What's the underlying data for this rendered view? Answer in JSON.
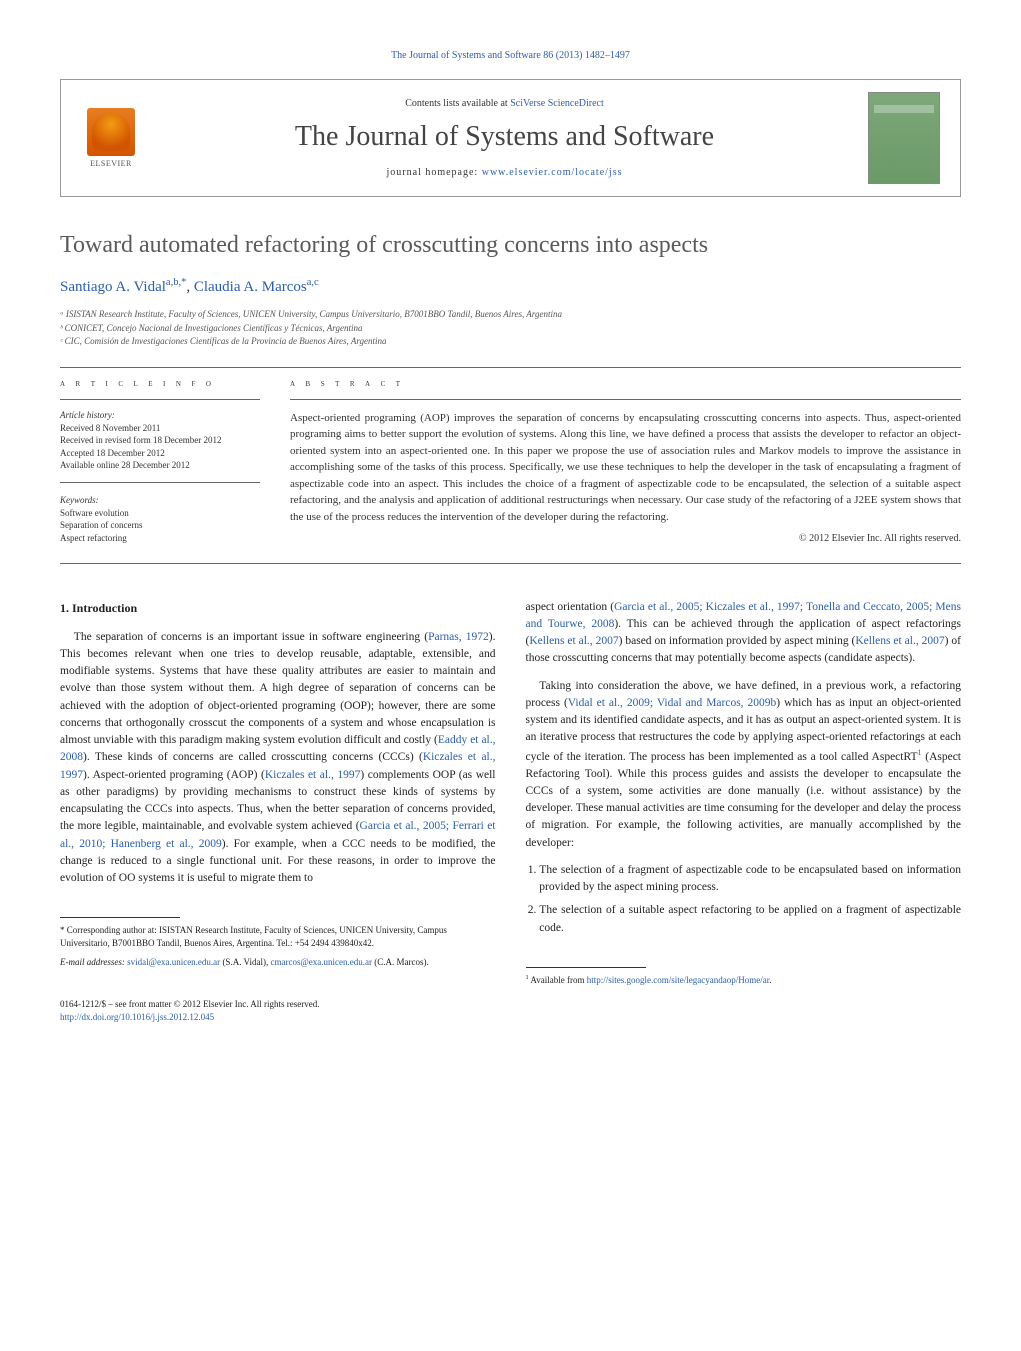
{
  "header_citation": "The Journal of Systems and Software 86 (2013) 1482–1497",
  "contents_line_prefix": "Contents lists available at ",
  "contents_line_link": "SciVerse ScienceDirect",
  "journal_title": "The Journal of Systems and Software",
  "homepage_prefix": "journal homepage: ",
  "homepage_link": "www.elsevier.com/locate/jss",
  "elsevier_label": "ELSEVIER",
  "article_title": "Toward automated refactoring of crosscutting concerns into aspects",
  "authors": {
    "a1_name": "Santiago A. Vidal",
    "a1_aff": "a,b,",
    "a1_star": "*",
    "sep": ", ",
    "a2_name": "Claudia A. Marcos",
    "a2_aff": "a,c"
  },
  "affiliations": {
    "a": "ᵃ ISISTAN Research Institute, Faculty of Sciences, UNICEN University, Campus Universitario, B7001BBO Tandil, Buenos Aires, Argentina",
    "b": "ᵇ CONICET, Concejo Nacional de Investigaciones Científicas y Técnicas, Argentina",
    "c": "ᶜ CIC, Comisión de Investigaciones Científicas de la Provincia de Buenos Aires, Argentina"
  },
  "info_header": "A R T I C L E   I N F O",
  "abstract_header": "A B S T R A C T",
  "history": {
    "label": "Article history:",
    "received": "Received 8 November 2011",
    "revised": "Received in revised form 18 December 2012",
    "accepted": "Accepted 18 December 2012",
    "online": "Available online 28 December 2012"
  },
  "keywords": {
    "label": "Keywords:",
    "k1": "Software evolution",
    "k2": "Separation of concerns",
    "k3": "Aspect refactoring"
  },
  "abstract_text": "Aspect-oriented programing (AOP) improves the separation of concerns by encapsulating crosscutting concerns into aspects. Thus, aspect-oriented programing aims to better support the evolution of systems. Along this line, we have defined a process that assists the developer to refactor an object-oriented system into an aspect-oriented one. In this paper we propose the use of association rules and Markov models to improve the assistance in accomplishing some of the tasks of this process. Specifically, we use these techniques to help the developer in the task of encapsulating a fragment of aspectizable code into an aspect. This includes the choice of a fragment of aspectizable code to be encapsulated, the selection of a suitable aspect refactoring, and the analysis and application of additional restructurings when necessary. Our case study of the refactoring of a J2EE system shows that the use of the process reduces the intervention of the developer during the refactoring.",
  "copyright": "© 2012 Elsevier Inc. All rights reserved.",
  "section1_heading": "1.  Introduction",
  "col1_p1_a": "The separation of concerns is an important issue in software engineering (",
  "col1_p1_ref1": "Parnas, 1972",
  "col1_p1_b": "). This becomes relevant when one tries to develop reusable, adaptable, extensible, and modifiable systems. Systems that have these quality attributes are easier to maintain and evolve than those system without them. A high degree of separation of concerns can be achieved with the adoption of object-oriented programing (OOP); however, there are some concerns that orthogonally crosscut the components of a system and whose encapsulation is almost unviable with this paradigm making system evolution difficult and costly (",
  "col1_p1_ref2": "Eaddy et al., 2008",
  "col1_p1_c": "). These kinds of concerns are called crosscutting concerns (CCCs) (",
  "col1_p1_ref3": "Kiczales et al., 1997",
  "col1_p1_d": "). Aspect-oriented programing (AOP) (",
  "col1_p1_ref4": "Kiczales et al., 1997",
  "col1_p1_e": ") complements OOP (as well as other paradigms) by providing mechanisms to construct these kinds of systems by encapsulating the CCCs into aspects. Thus, when the better separation of concerns provided, the more legible, maintainable, and evolvable system achieved (",
  "col1_p1_ref5": "Garcia et al., 2005; Ferrari et al., 2010; Hanenberg et al., 2009",
  "col1_p1_f": "). For example, when a CCC needs to be modified, the change is reduced to a single functional unit. For these reasons, in order to improve the evolution of OO systems it is useful to migrate them to",
  "col2_p1_a": "aspect orientation (",
  "col2_p1_ref1": "Garcia et al., 2005; Kiczales et al., 1997; Tonella and Ceccato, 2005; Mens and Tourwe, 2008",
  "col2_p1_b": "). This can be achieved through the application of aspect refactorings (",
  "col2_p1_ref2": "Kellens et al., 2007",
  "col2_p1_c": ") based on information provided by aspect mining (",
  "col2_p1_ref3": "Kellens et al., 2007",
  "col2_p1_d": ") of those crosscutting concerns that may potentially become aspects (candidate aspects).",
  "col2_p2_a": "Taking into consideration the above, we have defined, in a previous work, a refactoring process (",
  "col2_p2_ref1": "Vidal et al., 2009; Vidal and Marcos, 2009b",
  "col2_p2_b": ") which has as input an object-oriented system and its identified candidate aspects, and it has as output an aspect-oriented system. It is an iterative process that restructures the code by applying aspect-oriented refactorings at each cycle of the iteration. The process has been implemented as a tool called AspectRT",
  "col2_p2_sup": "1",
  "col2_p2_c": " (Aspect Refactoring Tool). While this process guides and assists the developer to encapsulate the CCCs of a system, some activities are done manually (i.e. without assistance) by the developer. These manual activities are time consuming for the developer and delay the process of migration. For example, the following activities, are manually accomplished by the developer:",
  "list_item1": "The selection of a fragment of aspectizable code to be encapsulated based on information provided by the aspect mining process.",
  "list_item2": "The selection of a suitable aspect refactoring to be applied on a fragment of aspectizable code.",
  "footnote_corr_a": "* Corresponding author at: ISISTAN Research Institute, Faculty of Sciences, UNICEN University, Campus Universitario, B7001BBO Tandil, Buenos Aires, Argentina. Tel.: +54 2494 439840x42.",
  "footnote_email_label": "E-mail addresses: ",
  "footnote_email1": "svidal@exa.unicen.edu.ar",
  "footnote_email1_who": " (S.A. Vidal), ",
  "footnote_email2": "cmarcos@exa.unicen.edu.ar",
  "footnote_email2_who": " (C.A. Marcos).",
  "footnote_right_num": "1",
  "footnote_right_a": " Available from ",
  "footnote_right_link": "http://sites.google.com/site/legacyandaop/Home/ar",
  "footnote_right_b": ".",
  "doi_line1": "0164-1212/$ – see front matter © 2012 Elsevier Inc. All rights reserved.",
  "doi_line2": "http://dx.doi.org/10.1016/j.jss.2012.12.045"
}
